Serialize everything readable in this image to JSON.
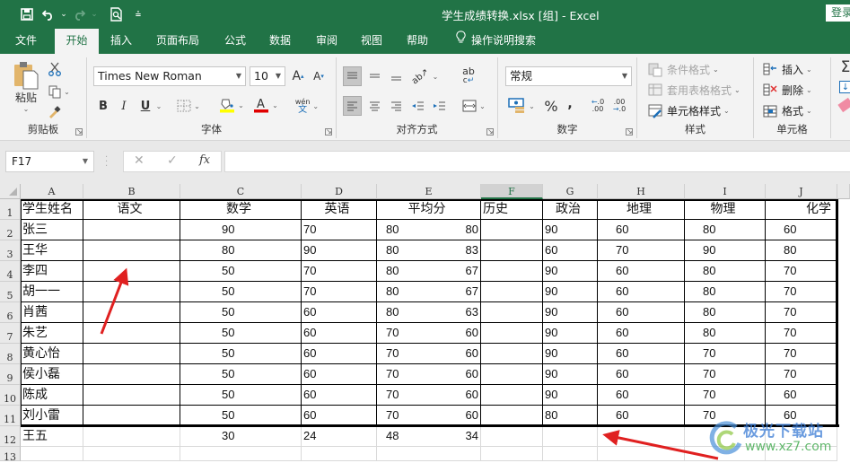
{
  "titlebar": {
    "title": "学生成绩转换.xlsx  [组]  -  Excel",
    "login": "登录",
    "qat": {
      "save_icon": "save-icon",
      "undo_icon": "undo-icon",
      "redo_icon": "redo-icon",
      "preview_icon": "print-preview-icon",
      "customize_icon": "customize-qat-icon"
    }
  },
  "tabs": [
    {
      "label": "文件"
    },
    {
      "label": "开始"
    },
    {
      "label": "插入"
    },
    {
      "label": "页面布局"
    },
    {
      "label": "公式"
    },
    {
      "label": "数据"
    },
    {
      "label": "审阅"
    },
    {
      "label": "视图"
    },
    {
      "label": "帮助"
    },
    {
      "label": "操作说明搜索"
    }
  ],
  "ribbon": {
    "clipboard": {
      "label": "剪贴板",
      "paste": "粘贴"
    },
    "font": {
      "label": "字体",
      "font_name": "Times New Roman",
      "font_size": "10",
      "bold": "B",
      "italic": "I",
      "underline": "U",
      "phonetic": "wén"
    },
    "alignment": {
      "label": "对齐方式"
    },
    "number": {
      "label": "数字",
      "format": "常规",
      "percent": "%",
      "comma": ","
    },
    "styles": {
      "label": "样式",
      "conditional": "条件格式",
      "table_format": "套用表格格式",
      "cell_styles": "单元格样式"
    },
    "cells": {
      "label": "单元格",
      "insert": "插入",
      "delete": "删除",
      "format": "格式"
    }
  },
  "formula_bar": {
    "name_box": "F17",
    "fx": "fx",
    "cancel": "✕",
    "enter": "✓",
    "formula": ""
  },
  "sheet": {
    "columns": [
      "A",
      "B",
      "C",
      "D",
      "E",
      "F",
      "G",
      "H",
      "I",
      "J"
    ],
    "active_column": "F",
    "row_numbers": [
      "1",
      "2",
      "3",
      "4",
      "5",
      "6",
      "7",
      "8",
      "9",
      "10",
      "11",
      "12",
      "13"
    ],
    "header_row": [
      "学生姓名",
      "语文",
      "数学",
      "英语",
      "平均分",
      "历史",
      "政治",
      "地理",
      "物理",
      "化学"
    ],
    "rows": [
      [
        "张三",
        "",
        "90",
        "70",
        "80",
        "80",
        "",
        "90",
        "60",
        "80",
        "60"
      ],
      [
        "王华",
        "",
        "80",
        "90",
        "80",
        "83",
        "",
        "60",
        "70",
        "90",
        "80"
      ],
      [
        "李四",
        "",
        "50",
        "70",
        "80",
        "67",
        "",
        "90",
        "60",
        "80",
        "70"
      ],
      [
        "胡一一",
        "",
        "50",
        "70",
        "80",
        "67",
        "",
        "90",
        "60",
        "80",
        "70"
      ],
      [
        "肖茜",
        "",
        "50",
        "60",
        "80",
        "63",
        "",
        "90",
        "60",
        "80",
        "70"
      ],
      [
        "朱艺",
        "",
        "50",
        "60",
        "70",
        "60",
        "",
        "90",
        "60",
        "80",
        "70"
      ],
      [
        "黄心怡",
        "",
        "50",
        "60",
        "70",
        "60",
        "",
        "90",
        "60",
        "70",
        "70"
      ],
      [
        "侯小磊",
        "",
        "50",
        "60",
        "70",
        "60",
        "",
        "90",
        "60",
        "70",
        "70"
      ],
      [
        "陈成",
        "",
        "50",
        "60",
        "70",
        "60",
        "",
        "90",
        "60",
        "70",
        "60"
      ],
      [
        "刘小雷",
        "",
        "50",
        "60",
        "70",
        "60",
        "",
        "80",
        "60",
        "70",
        "60"
      ],
      [
        "王五",
        "",
        "30",
        "24",
        "48",
        "34",
        "",
        "",
        "",
        "",
        ""
      ]
    ]
  },
  "watermark": {
    "title": "极光下载站",
    "url": "www.xz7.com"
  },
  "annotation_color": "#e02020",
  "brand_color": "#217346"
}
